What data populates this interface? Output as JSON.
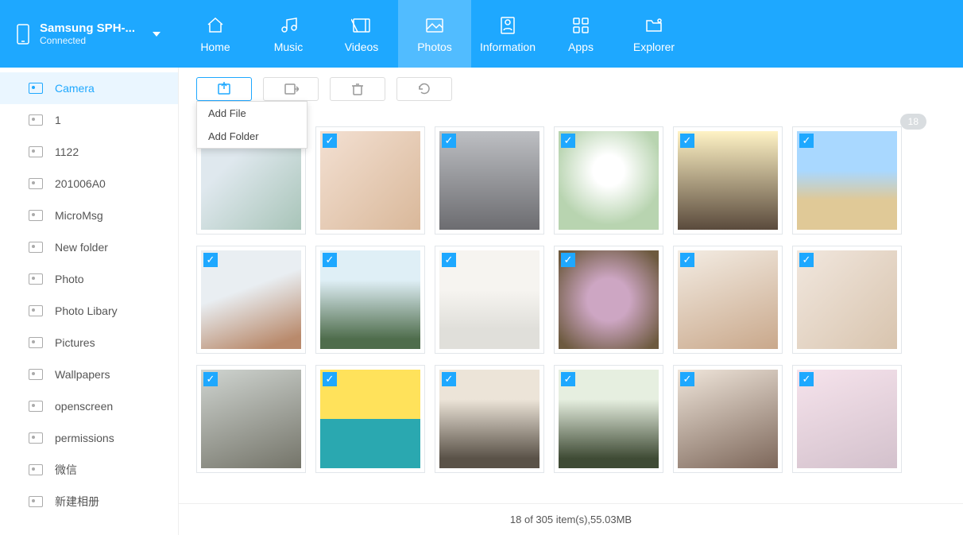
{
  "device": {
    "name": "Samsung SPH-...",
    "status": "Connected"
  },
  "nav": [
    {
      "label": "Home"
    },
    {
      "label": "Music"
    },
    {
      "label": "Videos"
    },
    {
      "label": "Photos",
      "active": true
    },
    {
      "label": "Information"
    },
    {
      "label": "Apps"
    },
    {
      "label": "Explorer"
    }
  ],
  "sidebar": [
    {
      "label": "Camera",
      "active": true
    },
    {
      "label": "1"
    },
    {
      "label": "1122"
    },
    {
      "label": "201006A0"
    },
    {
      "label": "MicroMsg"
    },
    {
      "label": "New folder"
    },
    {
      "label": "Photo"
    },
    {
      "label": "Photo Libary"
    },
    {
      "label": "Pictures"
    },
    {
      "label": "Wallpapers"
    },
    {
      "label": "openscreen"
    },
    {
      "label": "permissions"
    },
    {
      "label": "微信"
    },
    {
      "label": "新建相册"
    }
  ],
  "dropdown": {
    "addFile": "Add File",
    "addFolder": "Add Folder"
  },
  "badge": "18",
  "thumbs": 18,
  "status": "18 of 305 item(s),55.03MB"
}
